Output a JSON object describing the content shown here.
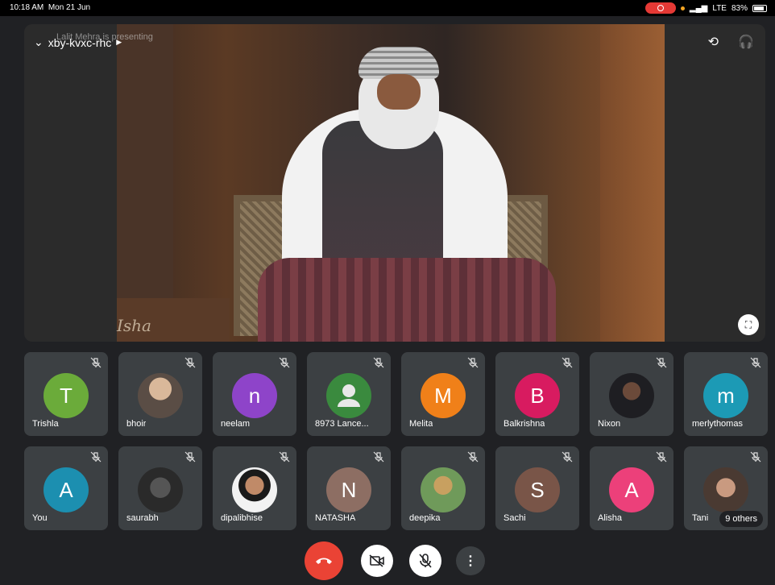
{
  "status_bar": {
    "time": "10:18 AM",
    "date": "Mon 21 Jun",
    "network": "LTE",
    "battery": "83%"
  },
  "header": {
    "meeting_code": "xby-kvxc-rhc",
    "presenting": "Lalit Mehra is presenting"
  },
  "main_video": {
    "watermark": "Isha"
  },
  "tiles": [
    {
      "name": "Trishla",
      "initial": "T",
      "color": "#6bab3a"
    },
    {
      "name": "bhoir",
      "initial": "",
      "color": "",
      "photo": true
    },
    {
      "name": "neelam",
      "initial": "n",
      "color": "#8e44c9"
    },
    {
      "name": "8973 Lance...",
      "initial": "",
      "color": "#3a8a3e",
      "generic": true
    },
    {
      "name": "Melita",
      "initial": "M",
      "color": "#f08019"
    },
    {
      "name": "Balkrishna",
      "initial": "B",
      "color": "#d81b60"
    },
    {
      "name": "Nixon",
      "initial": "",
      "color": "",
      "photo": true
    },
    {
      "name": "merlythomas",
      "initial": "m",
      "color": "#1c9ab5"
    },
    {
      "name": "You",
      "initial": "A",
      "color": "#1c8fb0"
    },
    {
      "name": "saurabh",
      "initial": "",
      "color": "",
      "photo": true
    },
    {
      "name": "dipalibhise",
      "initial": "",
      "color": "",
      "photo": true
    },
    {
      "name": "NATASHA",
      "initial": "N",
      "color": "#8d6e63"
    },
    {
      "name": "deepika",
      "initial": "",
      "color": "",
      "photo": true
    },
    {
      "name": "Sachi",
      "initial": "S",
      "color": "#795548"
    },
    {
      "name": "Alisha",
      "initial": "A",
      "color": "#ec407a"
    },
    {
      "name": "Tani",
      "initial": "",
      "color": "",
      "photo": true,
      "others": "9 others"
    }
  ]
}
